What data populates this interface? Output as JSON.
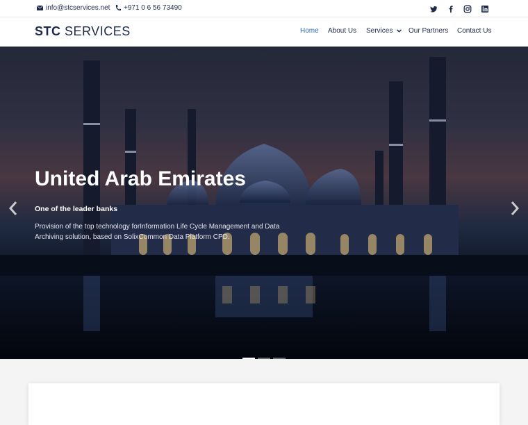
{
  "topbar": {
    "email": "info@stcservices.net",
    "email_icon": "envelope-icon",
    "phone": "+971 0 6 56 73490",
    "phone_icon": "phone-icon",
    "social": [
      "twitter-icon",
      "facebook-icon",
      "instagram-icon",
      "linkedin-icon"
    ]
  },
  "header": {
    "logo_bold": "STC",
    "logo_rest": " SERVICES",
    "nav": {
      "home": "Home",
      "about": "About Us",
      "services": "Services",
      "partners": "Our Partners",
      "contact": "Contact Us"
    }
  },
  "hero": {
    "title": "United Arab Emirates",
    "subtitle": "One of the leader banks",
    "description": "Provision of the top technology forInformation Life Cycle Management and Data Archiving solution, based on SolixCommon Data Platform CPD.",
    "active_slide": 1,
    "slide_count": 3
  },
  "colors": {
    "brand": "#1b2a4a",
    "nav_active": "#2a6cc4"
  }
}
